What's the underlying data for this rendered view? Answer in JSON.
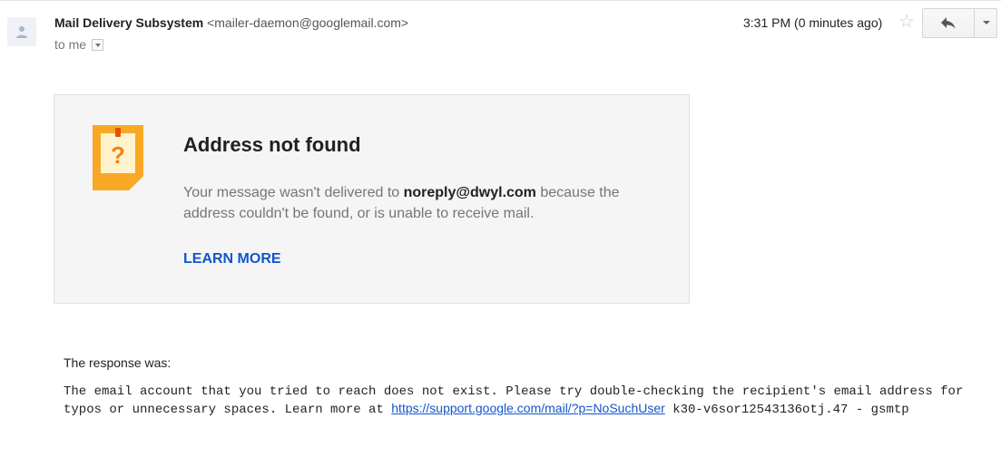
{
  "message": {
    "sender_name": "Mail Delivery Subsystem",
    "sender_email": "<mailer-daemon@googlemail.com>",
    "recipient_text": "to me",
    "time": "3:31 PM (0 minutes ago)"
  },
  "icons": {
    "avatar": "person-icon",
    "star": "star-icon",
    "reply": "reply-arrow-icon",
    "more": "chevron-down-icon",
    "notice": "question-note-icon"
  },
  "card": {
    "title": "Address not found",
    "body_prefix": "Your message wasn't delivered to ",
    "address": "noreply@dwyl.com",
    "body_suffix": " because the address couldn't be found, or is unable to receive mail.",
    "learn_more": "LEARN MORE"
  },
  "response": {
    "label": "The response was:",
    "text_before": "The email account that you tried to reach does not exist. Please try double-checking the recipient's email address for typos or unnecessary spaces. Learn more at ",
    "link": "https://support.google.com/mail/?p=NoSuchUser",
    "text_after": " k30-v6sor12543136otj.47 - gsmtp"
  },
  "colors": {
    "link": "#1155cc",
    "note_orange": "#f9a825",
    "card_background": "#f5f5f5"
  }
}
